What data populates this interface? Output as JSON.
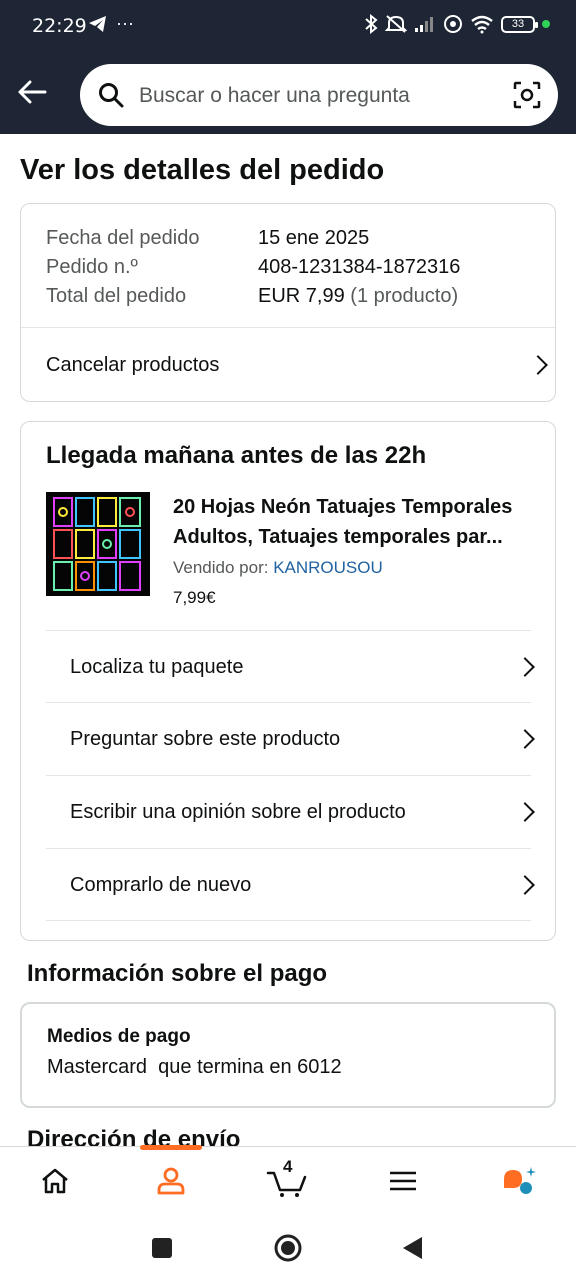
{
  "status_bar": {
    "time": "22:29",
    "battery": "33",
    "overflow": "···"
  },
  "search": {
    "placeholder": "Buscar o hacer una pregunta"
  },
  "page_title": "Ver los detalles del pedido",
  "summary": {
    "rows": [
      {
        "label": "Fecha del pedido",
        "value": "15 ene 2025",
        "extra": ""
      },
      {
        "label": "Pedido n.º",
        "value": "408-1231384-1872316",
        "extra": ""
      },
      {
        "label": "Total del pedido",
        "value": "EUR 7,99",
        "extra": "(1 producto)"
      }
    ],
    "cancel_label": "Cancelar productos"
  },
  "order": {
    "arrival": "Llegada mañana antes de las 22h",
    "product_title": "20 Hojas Neón Tatuajes Temporales Adultos, Tatuajes temporales par...",
    "sold_by_label": "Vendido por:",
    "seller": "KANROUSOU",
    "price": "7,99€",
    "actions": [
      "Localiza tu paquete",
      "Preguntar sobre este producto",
      "Escribir una opinión sobre el producto",
      "Comprarlo de nuevo"
    ]
  },
  "payment": {
    "section_title": "Información sobre el pago",
    "label": "Medios de pago",
    "value": "Mastercard  que termina en 6012"
  },
  "next_section": "Dirección de envío",
  "bottom_nav": {
    "items": [
      "home-icon",
      "account-icon",
      "cart-icon",
      "menu-icon",
      "rufus-icon"
    ],
    "cart_count": "4",
    "active": "account-icon",
    "accent": "#ff6d22"
  },
  "colors": {
    "header_bg": "#1e2636",
    "link": "#2162a1"
  }
}
